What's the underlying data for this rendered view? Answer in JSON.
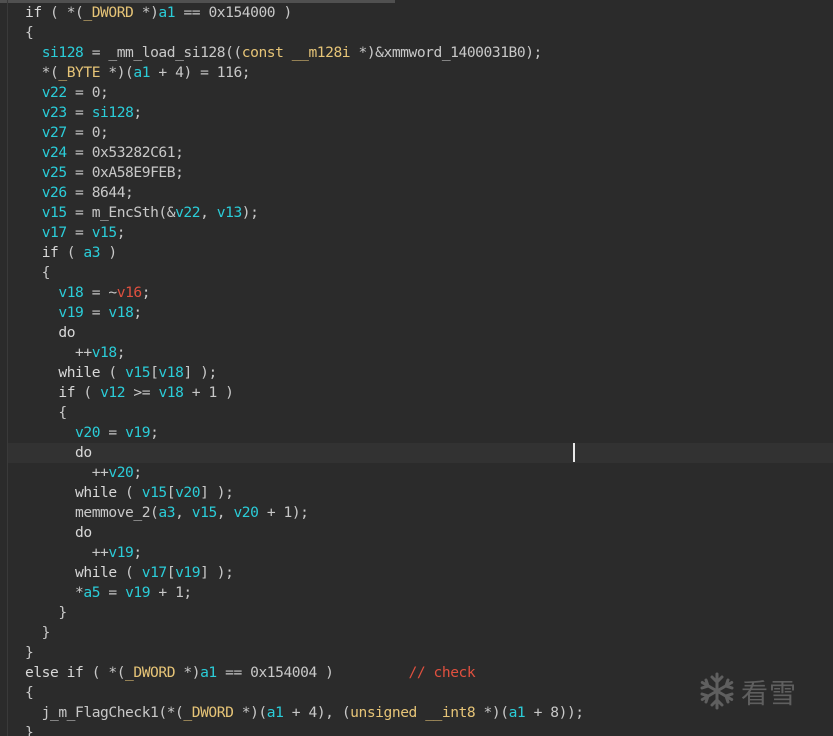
{
  "editor": {
    "watermark_text": "看雪",
    "watermark_icon": "snowflake-icon",
    "colors": {
      "background": "#2b2b2b",
      "identifier": "#2bcdd9",
      "type": "#e6c477",
      "comment": "#e0503f",
      "plain": "#c8c8c8"
    }
  },
  "code_lines": [
    [
      [
        "kw",
        "if"
      ],
      [
        "p",
        " ( *("
      ],
      [
        "typ",
        "_DWORD"
      ],
      [
        "p",
        " *)"
      ],
      [
        "var",
        "a1"
      ],
      [
        "p",
        " == 0x154000 )"
      ]
    ],
    [
      [
        "p",
        "{"
      ]
    ],
    [
      [
        "p",
        "  "
      ],
      [
        "var",
        "si128"
      ],
      [
        "p",
        " = _mm_load_si128(("
      ],
      [
        "typ",
        "const __m128i"
      ],
      [
        "p",
        " *)&xmmword_1400031B0);"
      ]
    ],
    [
      [
        "p",
        "  *("
      ],
      [
        "typ",
        "_BYTE"
      ],
      [
        "p",
        " *)("
      ],
      [
        "var",
        "a1"
      ],
      [
        "p",
        " + 4) = 116;"
      ]
    ],
    [
      [
        "p",
        "  "
      ],
      [
        "var",
        "v22"
      ],
      [
        "p",
        " = 0;"
      ]
    ],
    [
      [
        "p",
        "  "
      ],
      [
        "var",
        "v23"
      ],
      [
        "p",
        " = "
      ],
      [
        "var",
        "si128"
      ],
      [
        "p",
        ";"
      ]
    ],
    [
      [
        "p",
        "  "
      ],
      [
        "var",
        "v27"
      ],
      [
        "p",
        " = 0;"
      ]
    ],
    [
      [
        "p",
        "  "
      ],
      [
        "var",
        "v24"
      ],
      [
        "p",
        " = 0x53282C61;"
      ]
    ],
    [
      [
        "p",
        "  "
      ],
      [
        "var",
        "v25"
      ],
      [
        "p",
        " = 0xA58E9FEB;"
      ]
    ],
    [
      [
        "p",
        "  "
      ],
      [
        "var",
        "v26"
      ],
      [
        "p",
        " = 8644;"
      ]
    ],
    [
      [
        "p",
        "  "
      ],
      [
        "var",
        "v15"
      ],
      [
        "p",
        " = m_EncSth(&"
      ],
      [
        "var",
        "v22"
      ],
      [
        "p",
        ", "
      ],
      [
        "var",
        "v13"
      ],
      [
        "p",
        ");"
      ]
    ],
    [
      [
        "p",
        "  "
      ],
      [
        "var",
        "v17"
      ],
      [
        "p",
        " = "
      ],
      [
        "var",
        "v15"
      ],
      [
        "p",
        ";"
      ]
    ],
    [
      [
        "p",
        "  "
      ],
      [
        "kw",
        "if"
      ],
      [
        "p",
        " ( "
      ],
      [
        "var",
        "a3"
      ],
      [
        "p",
        " )"
      ]
    ],
    [
      [
        "p",
        "  {"
      ]
    ],
    [
      [
        "p",
        "    "
      ],
      [
        "var",
        "v18"
      ],
      [
        "p",
        " = ~"
      ],
      [
        "red",
        "v16"
      ],
      [
        "p",
        ";"
      ]
    ],
    [
      [
        "p",
        "    "
      ],
      [
        "var",
        "v19"
      ],
      [
        "p",
        " = "
      ],
      [
        "var",
        "v18"
      ],
      [
        "p",
        ";"
      ]
    ],
    [
      [
        "p",
        "    "
      ],
      [
        "kw",
        "do"
      ]
    ],
    [
      [
        "p",
        "      ++"
      ],
      [
        "var",
        "v18"
      ],
      [
        "p",
        ";"
      ]
    ],
    [
      [
        "p",
        "    "
      ],
      [
        "kw",
        "while"
      ],
      [
        "p",
        " ( "
      ],
      [
        "var",
        "v15"
      ],
      [
        "p",
        "["
      ],
      [
        "var",
        "v18"
      ],
      [
        "p",
        "] );"
      ]
    ],
    [
      [
        "p",
        "    "
      ],
      [
        "kw",
        "if"
      ],
      [
        "p",
        " ( "
      ],
      [
        "var",
        "v12"
      ],
      [
        "p",
        " >= "
      ],
      [
        "var",
        "v18"
      ],
      [
        "p",
        " + 1 )"
      ]
    ],
    [
      [
        "p",
        "    {"
      ]
    ],
    [
      [
        "p",
        "      "
      ],
      [
        "var",
        "v20"
      ],
      [
        "p",
        " = "
      ],
      [
        "var",
        "v19"
      ],
      [
        "p",
        ";"
      ]
    ],
    [
      [
        "p",
        "      "
      ],
      [
        "kw",
        "do"
      ]
    ],
    [
      [
        "p",
        "        ++"
      ],
      [
        "var",
        "v20"
      ],
      [
        "p",
        ";"
      ]
    ],
    [
      [
        "p",
        "      "
      ],
      [
        "kw",
        "while"
      ],
      [
        "p",
        " ( "
      ],
      [
        "var",
        "v15"
      ],
      [
        "p",
        "["
      ],
      [
        "var",
        "v20"
      ],
      [
        "p",
        "] );"
      ]
    ],
    [
      [
        "p",
        "      memmove_2("
      ],
      [
        "var",
        "a3"
      ],
      [
        "p",
        ", "
      ],
      [
        "var",
        "v15"
      ],
      [
        "p",
        ", "
      ],
      [
        "var",
        "v20"
      ],
      [
        "p",
        " + 1);"
      ]
    ],
    [
      [
        "p",
        "      "
      ],
      [
        "kw",
        "do"
      ]
    ],
    [
      [
        "p",
        "        ++"
      ],
      [
        "var",
        "v19"
      ],
      [
        "p",
        ";"
      ]
    ],
    [
      [
        "p",
        "      "
      ],
      [
        "kw",
        "while"
      ],
      [
        "p",
        " ( "
      ],
      [
        "var",
        "v17"
      ],
      [
        "p",
        "["
      ],
      [
        "var",
        "v19"
      ],
      [
        "p",
        "] );"
      ]
    ],
    [
      [
        "p",
        "      *"
      ],
      [
        "var",
        "a5"
      ],
      [
        "p",
        " = "
      ],
      [
        "var",
        "v19"
      ],
      [
        "p",
        " + 1;"
      ]
    ],
    [
      [
        "p",
        "    }"
      ]
    ],
    [
      [
        "p",
        "  }"
      ]
    ],
    [
      [
        "p",
        "}"
      ]
    ],
    [
      [
        "kw",
        "else if"
      ],
      [
        "p",
        " ( *("
      ],
      [
        "typ",
        "_DWORD"
      ],
      [
        "p",
        " *)"
      ],
      [
        "var",
        "a1"
      ],
      [
        "p",
        " == 0x154004 )         "
      ],
      [
        "cmt",
        "// check"
      ]
    ],
    [
      [
        "p",
        "{"
      ]
    ],
    [
      [
        "p",
        "  j_m_FlagCheck1(*("
      ],
      [
        "typ",
        "_DWORD"
      ],
      [
        "p",
        " *)("
      ],
      [
        "var",
        "a1"
      ],
      [
        "p",
        " + 4), ("
      ],
      [
        "typ",
        "unsigned __int8"
      ],
      [
        "p",
        " *)("
      ],
      [
        "var",
        "a1"
      ],
      [
        "p",
        " + 8));"
      ]
    ],
    [
      [
        "p",
        "}"
      ]
    ]
  ]
}
